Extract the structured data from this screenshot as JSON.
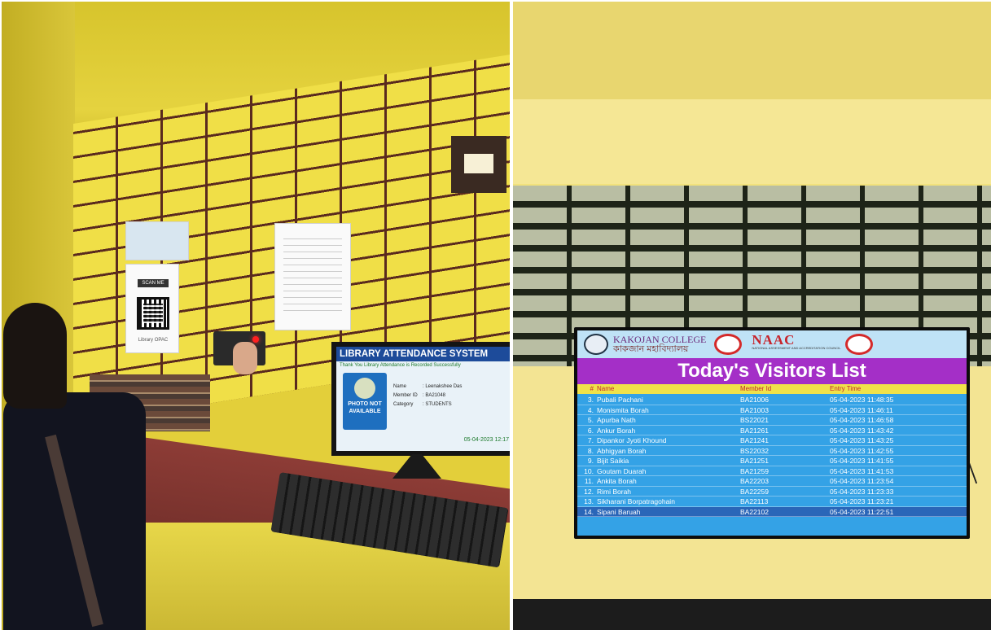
{
  "left_photo": {
    "qr_sign": {
      "scan_label": "SCAN ME",
      "caption": "Library OPAC"
    },
    "monitor": {
      "title": "LIBRARY ATTENDANCE SYSTEM",
      "subtitle": "Thank You Library Attendance is Recorded Successfully",
      "photo_placeholder": "PHOTO NOT AVAILABLE",
      "fields": [
        {
          "label": "Name",
          "value": ": Leenakshee Das"
        },
        {
          "label": "Member ID",
          "value": ": BA21048"
        },
        {
          "label": "Category",
          "value": ": STUDENTS"
        }
      ],
      "date": "05-04-2023 12:17"
    }
  },
  "right_photo": {
    "tv": {
      "college_name_en": "KAKOJAN COLLEGE",
      "college_name_bn": "কাকজান মহাবিদ্যালয়",
      "naac_label": "NAAC",
      "naac_sub": "NATIONAL ASSESSMENT AND ACCREDITATION COUNCIL",
      "title": "Today's Visitors List",
      "columns": {
        "num": "#",
        "name": "Name",
        "member_id": "Member Id",
        "entry_time": "Entry Time"
      },
      "rows": [
        {
          "num": "3.",
          "name": "Pubali Pachani",
          "member_id": "BA21006",
          "entry_time": "05-04-2023 11:48:35"
        },
        {
          "num": "4.",
          "name": "Monismita Borah",
          "member_id": "BA21003",
          "entry_time": "05-04-2023 11:46:11"
        },
        {
          "num": "5.",
          "name": "Apurba Nath",
          "member_id": "BS22021",
          "entry_time": "05-04-2023 11:46:58"
        },
        {
          "num": "6.",
          "name": "Ankur Borah",
          "member_id": "BA21261",
          "entry_time": "05-04-2023 11:43:42"
        },
        {
          "num": "7.",
          "name": "Dipankor Jyoti Khound",
          "member_id": "BA21241",
          "entry_time": "05-04-2023 11:43:25"
        },
        {
          "num": "8.",
          "name": "Abhigyan Borah",
          "member_id": "BS22032",
          "entry_time": "05-04-2023 11:42:55"
        },
        {
          "num": "9.",
          "name": "Bijit Saikia",
          "member_id": "BA21251",
          "entry_time": "05-04-2023 11:41:55"
        },
        {
          "num": "10.",
          "name": "Goutam Duarah",
          "member_id": "BA21259",
          "entry_time": "05-04-2023 11:41:53"
        },
        {
          "num": "11.",
          "name": "Ankita Borah",
          "member_id": "BA22203",
          "entry_time": "05-04-2023 11:23:54"
        },
        {
          "num": "12.",
          "name": "Rimi Borah",
          "member_id": "BA22259",
          "entry_time": "05-04-2023 11:23:33"
        },
        {
          "num": "13.",
          "name": "Sikharani Borpatragohain",
          "member_id": "BA22113",
          "entry_time": "05-04-2023 11:23:21"
        },
        {
          "num": "14.",
          "name": "Sipani Baruah",
          "member_id": "BA22102",
          "entry_time": "05-04-2023 11:22:51"
        }
      ]
    }
  }
}
